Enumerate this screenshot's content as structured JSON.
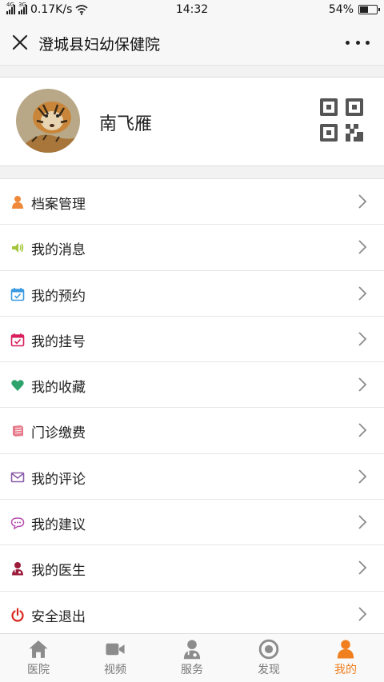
{
  "status_bar": {
    "net1": "4G",
    "net2": "3G",
    "speed": "0.17K/s",
    "time": "14:32",
    "battery": "54%",
    "battery_level": 0.54
  },
  "header": {
    "title": "澄城县妇幼保健院"
  },
  "profile": {
    "name": "南飞雁"
  },
  "menu": [
    {
      "label": "档案管理",
      "icon": "person-icon",
      "color": "#f0883a"
    },
    {
      "label": "我的消息",
      "icon": "speaker-icon",
      "color": "#a4c43a"
    },
    {
      "label": "我的预约",
      "icon": "calendar-check-icon",
      "color": "#3a9ae0"
    },
    {
      "label": "我的挂号",
      "icon": "calendar-check-icon",
      "color": "#d81e5b"
    },
    {
      "label": "我的收藏",
      "icon": "heart-icon",
      "color": "#2ea36b"
    },
    {
      "label": "门诊缴费",
      "icon": "book-icon",
      "color": "#e77a8a"
    },
    {
      "label": "我的评论",
      "icon": "envelope-icon",
      "color": "#8a5ca8"
    },
    {
      "label": "我的建议",
      "icon": "chat-icon",
      "color": "#b84db0"
    },
    {
      "label": "我的医生",
      "icon": "doctor-icon",
      "color": "#9b1b3a"
    },
    {
      "label": "安全退出",
      "icon": "power-icon",
      "color": "#d9261c"
    }
  ],
  "tabbar": [
    {
      "label": "医院",
      "icon": "home-icon"
    },
    {
      "label": "视频",
      "icon": "video-icon"
    },
    {
      "label": "服务",
      "icon": "doctor-icon"
    },
    {
      "label": "发现",
      "icon": "target-icon"
    },
    {
      "label": "我的",
      "icon": "person-icon",
      "active": true
    }
  ],
  "colors": {
    "accent": "#f07f1e",
    "tab_inactive": "#8c8c8c"
  }
}
